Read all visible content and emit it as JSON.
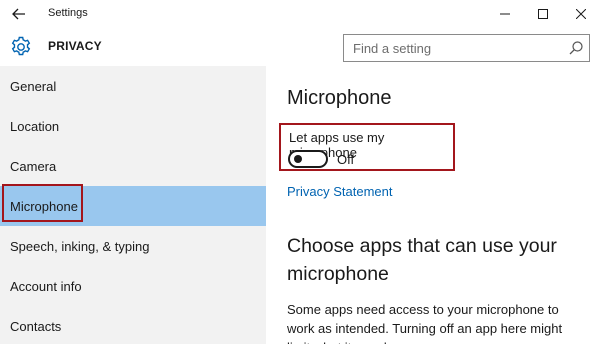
{
  "window": {
    "title": "Settings",
    "controls": {
      "minimize": "minimize",
      "maximize": "maximize",
      "close": "close"
    }
  },
  "header": {
    "section_title": "PRIVACY",
    "search": {
      "placeholder": "Find a setting",
      "value": ""
    }
  },
  "sidebar": {
    "items": [
      {
        "label": "General"
      },
      {
        "label": "Location"
      },
      {
        "label": "Camera"
      },
      {
        "label": "Microphone",
        "selected": true
      },
      {
        "label": "Speech, inking, & typing"
      },
      {
        "label": "Account info"
      },
      {
        "label": "Contacts"
      }
    ]
  },
  "main": {
    "title": "Microphone",
    "toggle": {
      "label": "Let apps use my microphone",
      "state_text": "Off",
      "on": false
    },
    "privacy_link": "Privacy Statement",
    "apps_heading": "Choose apps that can use your microphone",
    "apps_description": "Some apps need access to your microphone to work as intended. Turning off an app here might limit what it can do."
  },
  "colors": {
    "accent": "#0063b1",
    "selected_nav": "#99c7ee",
    "highlight_border": "#a3161c",
    "sidebar_bg": "#f2f2f2"
  }
}
